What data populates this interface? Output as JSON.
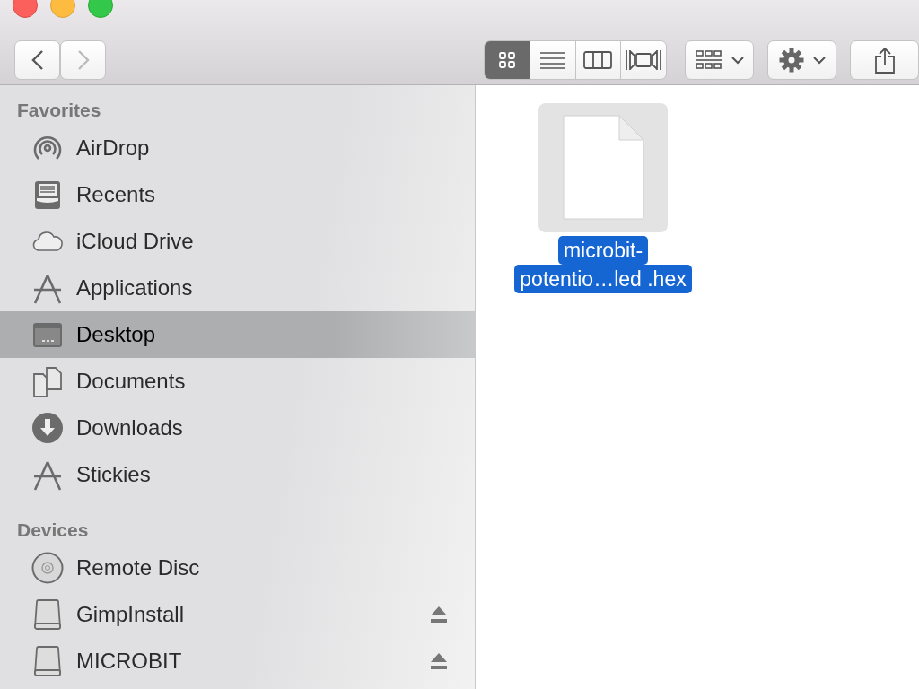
{
  "toolbar": {
    "back": {
      "disabled": false
    },
    "forward": {
      "disabled": true
    },
    "view_buttons": [
      {
        "kind": "icons",
        "selected": true
      },
      {
        "kind": "list",
        "selected": false
      },
      {
        "kind": "columns",
        "selected": false
      },
      {
        "kind": "gallery",
        "selected": false
      }
    ]
  },
  "sidebar": {
    "sections": [
      {
        "title": "Favorites",
        "items": [
          {
            "label": "AirDrop",
            "kind": "airdrop",
            "selected": false,
            "eject": false
          },
          {
            "label": "Recents",
            "kind": "recents",
            "selected": false,
            "eject": false
          },
          {
            "label": "iCloud Drive",
            "kind": "cloud",
            "selected": false,
            "eject": false
          },
          {
            "label": "Applications",
            "kind": "apps",
            "selected": false,
            "eject": false
          },
          {
            "label": "Desktop",
            "kind": "desktop",
            "selected": true,
            "eject": false
          },
          {
            "label": "Documents",
            "kind": "documents",
            "selected": false,
            "eject": false
          },
          {
            "label": "Downloads",
            "kind": "downloads",
            "selected": false,
            "eject": false
          },
          {
            "label": "Stickies",
            "kind": "apps",
            "selected": false,
            "eject": false
          }
        ]
      },
      {
        "title": "Devices",
        "items": [
          {
            "label": "Remote Disc",
            "kind": "disc",
            "selected": false,
            "eject": false
          },
          {
            "label": "GimpInstall",
            "kind": "drive",
            "selected": false,
            "eject": true
          },
          {
            "label": "MICROBIT",
            "kind": "drive",
            "selected": false,
            "eject": true
          }
        ]
      }
    ]
  },
  "files": [
    {
      "name_lines": [
        "microbit-",
        "potentio…led .hex"
      ],
      "selected": true
    }
  ]
}
